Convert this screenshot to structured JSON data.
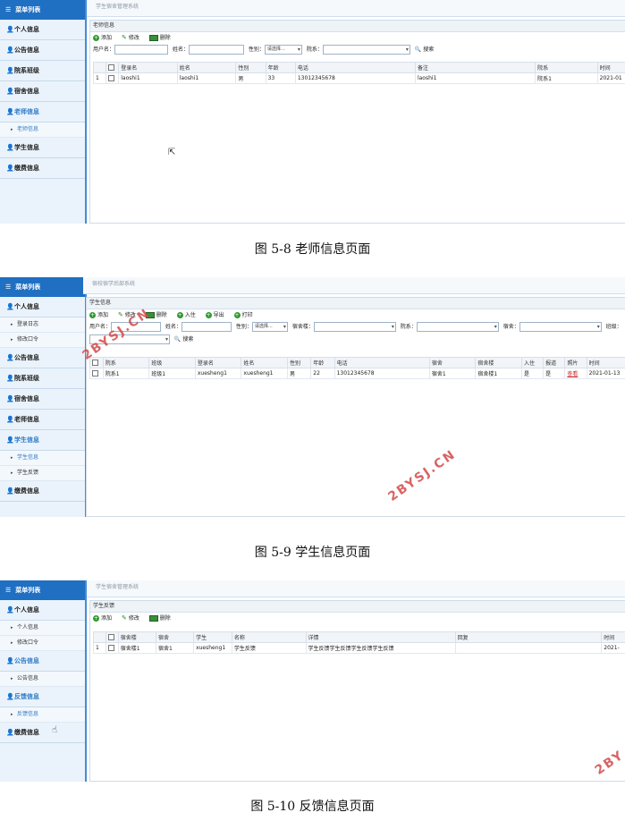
{
  "fig1": {
    "sidebar_title": "菜单列表",
    "groups": [
      {
        "label": "个人信息"
      },
      {
        "label": "公告信息"
      },
      {
        "label": "院系班级"
      },
      {
        "label": "宿舍信息"
      },
      {
        "label": "老师信息",
        "active": true,
        "subs": [
          "老师信息"
        ]
      },
      {
        "label": "学生信息"
      },
      {
        "label": "缴费信息"
      }
    ],
    "topbar": "学生宿舍管理系统",
    "panel_title": "老师信息",
    "toolbar": {
      "add": "添加",
      "edit": "修改",
      "delete": "删除"
    },
    "filters": {
      "username": "用户名：",
      "name": "姓名：",
      "gender": "性别：",
      "gender_value": "请选择...",
      "dept": "院系：",
      "search": "搜索"
    },
    "columns": [
      "",
      "",
      "登录名",
      "姓名",
      "性别",
      "年龄",
      "电话",
      "备注",
      "院系",
      "时间"
    ],
    "rows": [
      [
        "1",
        "",
        "laoshi1",
        "laoshi1",
        "男",
        "33",
        "13012345678",
        "laoshi1",
        "院系1",
        "2021-01"
      ]
    ],
    "caption": "图 5-8 老师信息页面"
  },
  "fig2": {
    "sidebar_title": "菜单列表",
    "topbar": "宿校宿学后部系统",
    "panel_title": "学生信息",
    "toolbar": {
      "add": "添加",
      "edit": "修改",
      "delete": "删除",
      "checkin": "入住",
      "export": "导出",
      "print": "打印"
    },
    "filters": {
      "username": "用户名：",
      "name": "姓名：",
      "gender": "性别：",
      "gender_value": "请选择...",
      "building": "宿舍楼：",
      "dept": "院系：",
      "dorm": "宿舍：",
      "class": "班级：",
      "search": "搜索"
    },
    "columns": [
      "",
      "院系",
      "班级",
      "登录名",
      "姓名",
      "性别",
      "年龄",
      "电话",
      "宿舍",
      "宿舍楼",
      "入住",
      "报道",
      "照片",
      "时间"
    ],
    "rows": [
      [
        "",
        "院系1",
        "班级1",
        "xuesheng1",
        "xuesheng1",
        "男",
        "22",
        "13012345678",
        "宿舍1",
        "宿舍楼1",
        "是",
        "是",
        "查看",
        "2021-01-13"
      ]
    ],
    "watermark": "2BYSJ.CN",
    "caption": "图 5-9 学生信息页面"
  },
  "fig3": {
    "sidebar_title": "菜单列表",
    "topbar": "学生宿舍管理系统",
    "panel_title": "学生反馈",
    "toolbar": {
      "add": "添加",
      "edit": "修改",
      "delete": "删除"
    },
    "columns": [
      "",
      "",
      "宿舍楼",
      "宿舍",
      "学生",
      "名称",
      "详情",
      "回复",
      "时间"
    ],
    "rows": [
      [
        "1",
        "",
        "宿舍楼1",
        "宿舍1",
        "xuesheng1",
        "学生反馈",
        "学生反馈学生反馈学生反馈学生反馈",
        "",
        "2021-"
      ]
    ],
    "watermark": "2BY",
    "caption": "图 5-10 反馈信息页面"
  },
  "fig2_sidebar": [
    {
      "type": "group",
      "label": "个人信息"
    },
    {
      "type": "sub",
      "label": "登录日志"
    },
    {
      "type": "sub",
      "label": "修改口令"
    },
    {
      "type": "group",
      "label": "公告信息"
    },
    {
      "type": "group",
      "label": "院系班级"
    },
    {
      "type": "group",
      "label": "宿舍信息"
    },
    {
      "type": "group",
      "label": "老师信息"
    },
    {
      "type": "group",
      "label": "学生信息",
      "active": true
    },
    {
      "type": "sub",
      "label": "学生信息",
      "active": true
    },
    {
      "type": "sub",
      "label": "学生反馈"
    },
    {
      "type": "group",
      "label": "缴费信息"
    }
  ],
  "fig3_sidebar": [
    {
      "type": "group",
      "label": "个人信息"
    },
    {
      "type": "sub",
      "label": "个人信息"
    },
    {
      "type": "sub",
      "label": "修改口令"
    },
    {
      "type": "group",
      "label": "公告信息",
      "active": true
    },
    {
      "type": "sub",
      "label": "公告信息"
    },
    {
      "type": "group",
      "label": "反馈信息",
      "active": true
    },
    {
      "type": "sub",
      "label": "反馈信息",
      "active": true
    },
    {
      "type": "group",
      "label": "缴费信息"
    }
  ]
}
